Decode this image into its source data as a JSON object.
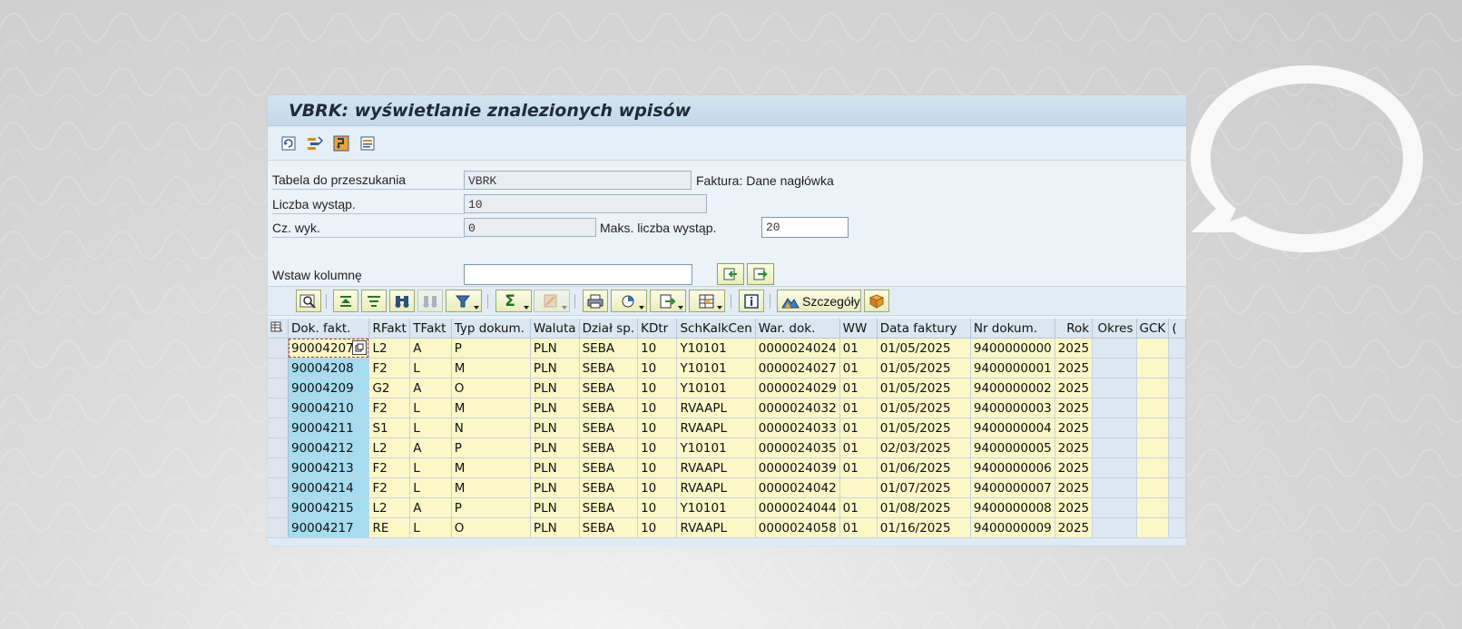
{
  "window": {
    "title": "VBRK: wyświetlanie znalezionych wpisów"
  },
  "app_toolbar": {
    "icons": [
      "refresh-icon",
      "selection-options-icon",
      "check-table-icon",
      "field-list-icon"
    ]
  },
  "form": {
    "table_label": "Tabela do przeszukania",
    "table_value": "VBRK",
    "table_desc": "Faktura: Dane nagłówka",
    "count_label": "Liczba wystąp.",
    "count_value": "10",
    "runtime_label": "Cz. wyk.",
    "runtime_value": "0",
    "max_label": "Maks. liczba wystąp.",
    "max_value": "20",
    "insert_col_label": "Wstaw kolumnę",
    "insert_col_value": ""
  },
  "alv_toolbar": {
    "details_label": "Szczegóły"
  },
  "grid": {
    "columns": [
      "Dok. fakt.",
      "RFakt",
      "TFakt",
      "Typ dokum.",
      "Waluta",
      "Dział sp.",
      "KDtr",
      "SchKalkCen",
      "War. dok.",
      "WW",
      "Data faktury",
      "Nr dokum.",
      "Rok",
      "Okres",
      "GCK",
      "("
    ],
    "rows": [
      [
        "90004207",
        "L2",
        "A",
        "P",
        "PLN",
        "SEBA",
        "10",
        "Y10101",
        "0000024024",
        "01",
        "01/05/2025",
        "9400000000",
        "2025",
        "",
        "",
        ""
      ],
      [
        "90004208",
        "F2",
        "L",
        "M",
        "PLN",
        "SEBA",
        "10",
        "Y10101",
        "0000024027",
        "01",
        "01/05/2025",
        "9400000001",
        "2025",
        "",
        "",
        ""
      ],
      [
        "90004209",
        "G2",
        "A",
        "O",
        "PLN",
        "SEBA",
        "10",
        "Y10101",
        "0000024029",
        "01",
        "01/05/2025",
        "9400000002",
        "2025",
        "",
        "",
        ""
      ],
      [
        "90004210",
        "F2",
        "L",
        "M",
        "PLN",
        "SEBA",
        "10",
        "RVAAPL",
        "0000024032",
        "01",
        "01/05/2025",
        "9400000003",
        "2025",
        "",
        "",
        ""
      ],
      [
        "90004211",
        "S1",
        "L",
        "N",
        "PLN",
        "SEBA",
        "10",
        "RVAAPL",
        "0000024033",
        "01",
        "01/05/2025",
        "9400000004",
        "2025",
        "",
        "",
        ""
      ],
      [
        "90004212",
        "L2",
        "A",
        "P",
        "PLN",
        "SEBA",
        "10",
        "Y10101",
        "0000024035",
        "01",
        "02/03/2025",
        "9400000005",
        "2025",
        "",
        "",
        ""
      ],
      [
        "90004213",
        "F2",
        "L",
        "M",
        "PLN",
        "SEBA",
        "10",
        "RVAAPL",
        "0000024039",
        "01",
        "01/06/2025",
        "9400000006",
        "2025",
        "",
        "",
        ""
      ],
      [
        "90004214",
        "F2",
        "L",
        "M",
        "PLN",
        "SEBA",
        "10",
        "RVAAPL",
        "0000024042",
        "",
        "01/07/2025",
        "9400000007",
        "2025",
        "",
        "",
        ""
      ],
      [
        "90004215",
        "L2",
        "A",
        "P",
        "PLN",
        "SEBA",
        "10",
        "Y10101",
        "0000024044",
        "01",
        "01/08/2025",
        "9400000008",
        "2025",
        "",
        "",
        ""
      ],
      [
        "90004217",
        "RE",
        "L",
        "O",
        "PLN",
        "SEBA",
        "10",
        "RVAAPL",
        "0000024058",
        "01",
        "01/16/2025",
        "9400000009",
        "2025",
        "",
        "",
        ""
      ]
    ]
  },
  "colors": {
    "key_column": "#a6dcef",
    "data_cell": "#fbf7c7",
    "title_bar": "#c4d7ea"
  }
}
